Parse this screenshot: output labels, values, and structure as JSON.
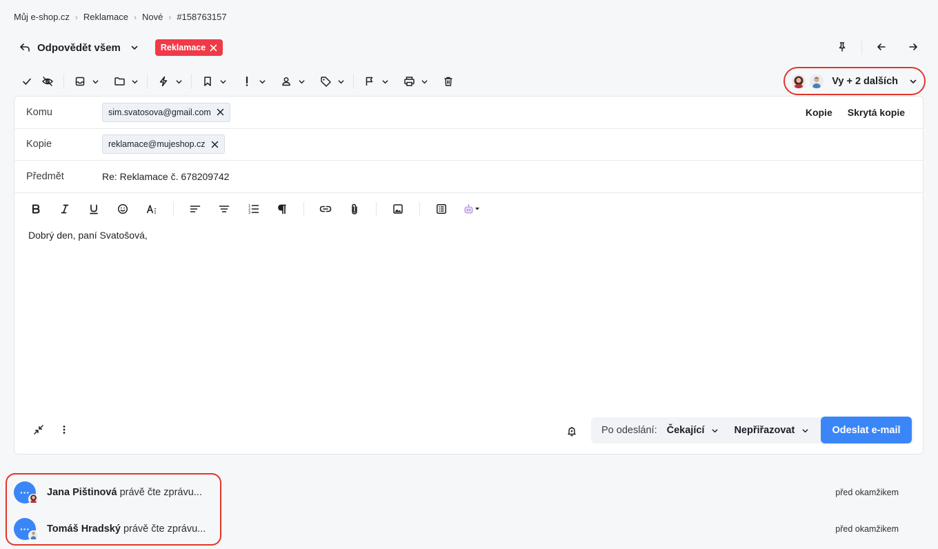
{
  "breadcrumb": [
    "Můj e-shop.cz",
    "Reklamace",
    "Nové",
    "#158763157"
  ],
  "header": {
    "reply_label": "Odpovědět všem",
    "tag_label": "Reklamace",
    "tag_color": "#f03a48"
  },
  "toolbar": {
    "icons": [
      "check-icon",
      "hide-icon",
      "inbox-icon",
      "folder-icon",
      "bolt-icon",
      "bookmark-icon",
      "priority-icon",
      "user-icon",
      "tag-icon",
      "flag-icon",
      "print-icon",
      "trash-icon"
    ]
  },
  "participants": {
    "label": "Vy + 2 dalších"
  },
  "compose": {
    "to_label": "Komu",
    "to_value": "sim.svatosova@gmail.com",
    "cc_label": "Kopie",
    "cc_value": "reklamace@mujeshop.cz",
    "subject_label": "Předmět",
    "subject_value": "Re: Reklamace č. 678209742",
    "cc_link": "Kopie",
    "bcc_link": "Skrytá kopie",
    "body": "Dobrý den, paní Svatošová,"
  },
  "footer": {
    "after_send_label": "Po odeslání:",
    "status_value": "Čekající",
    "assign_value": "Nepřiřazovat",
    "send_label": "Odeslat e-mail",
    "accent": "#3b86f7"
  },
  "readers": [
    {
      "name": "Jana Pištinová",
      "action": "právě čte zprávu...",
      "time": "před okamžikem",
      "bubble": "···"
    },
    {
      "name": "Tomáš Hradský",
      "action": "právě čte zprávu...",
      "time": "před okamžikem",
      "bubble": "···"
    }
  ]
}
